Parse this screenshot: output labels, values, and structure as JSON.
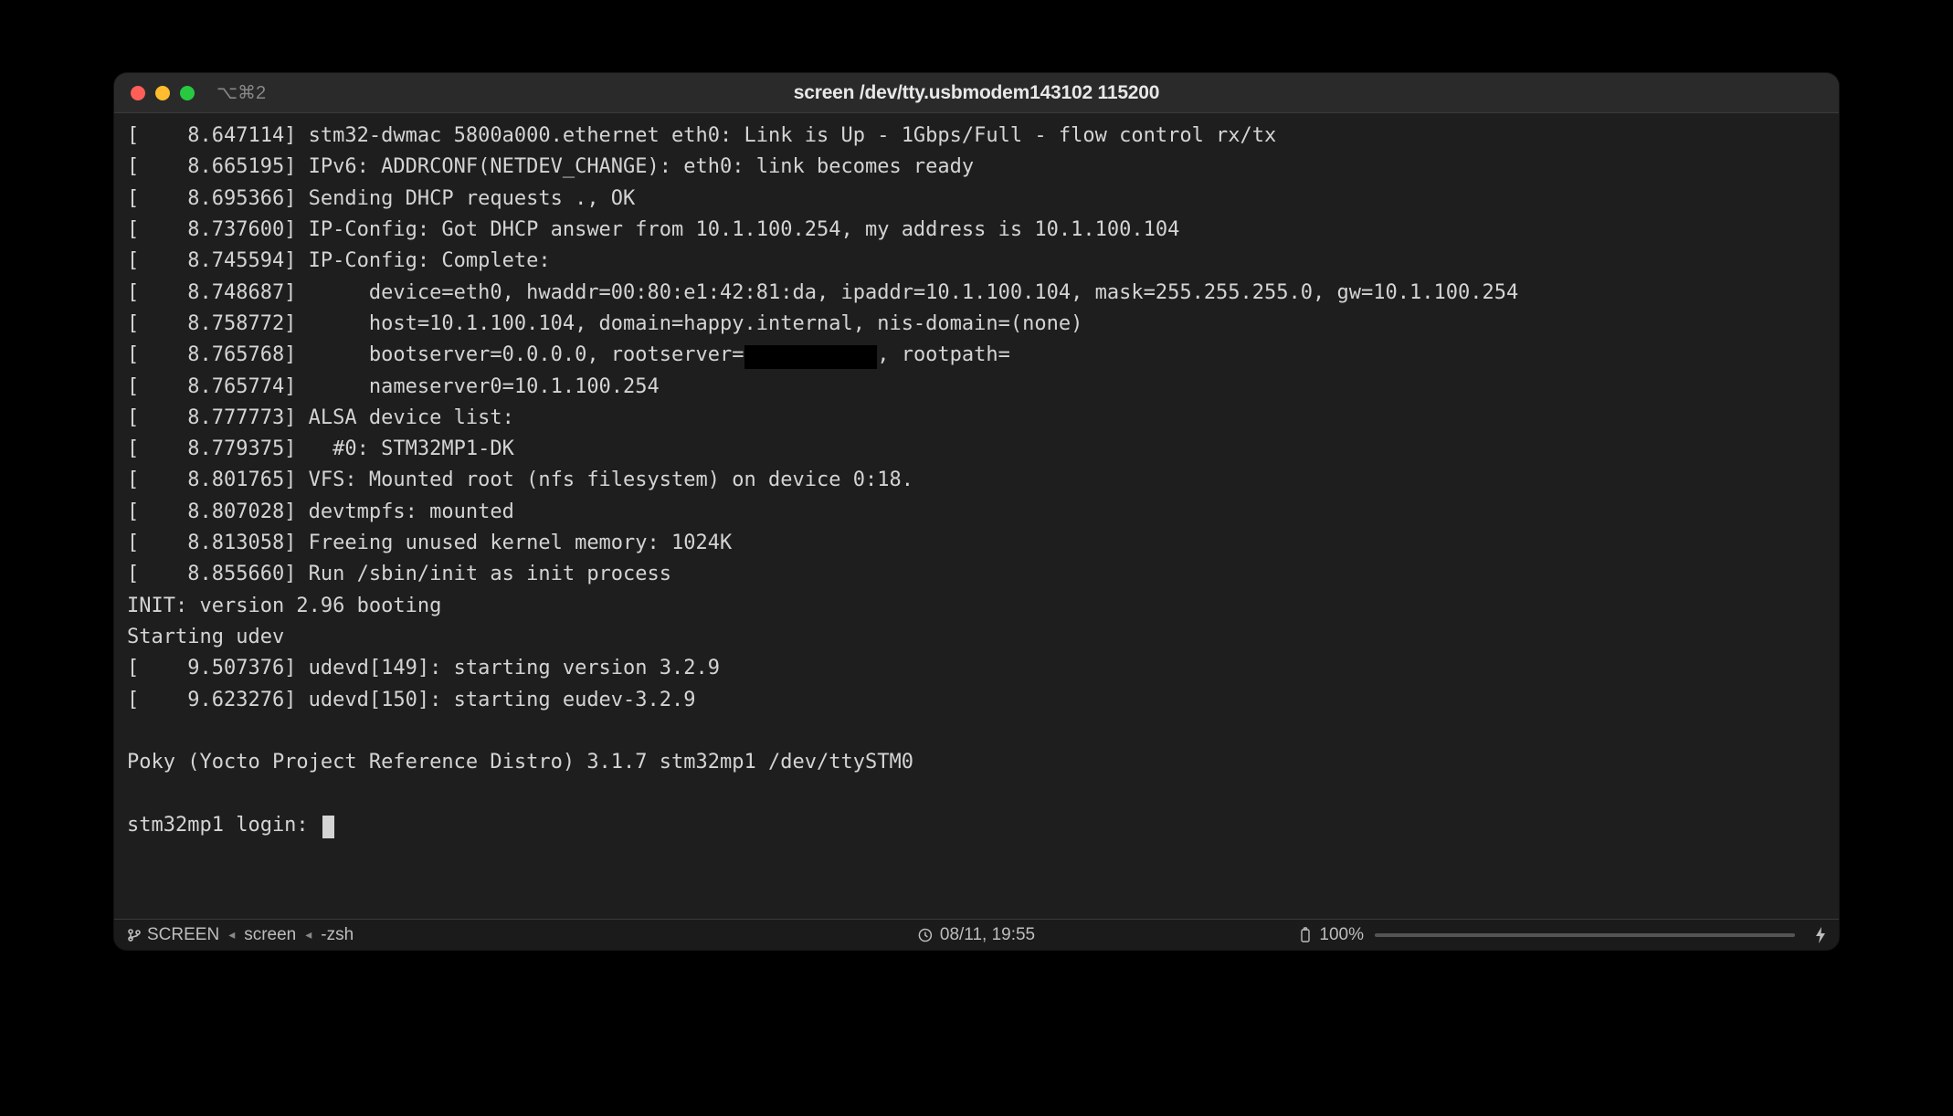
{
  "window": {
    "title": "screen /dev/tty.usbmodem143102 115200",
    "session_hint": "⌥⌘2"
  },
  "terminal": {
    "lines": [
      "[    8.647114] stm32-dwmac 5800a000.ethernet eth0: Link is Up - 1Gbps/Full - flow control rx/tx",
      "[    8.665195] IPv6: ADDRCONF(NETDEV_CHANGE): eth0: link becomes ready",
      "[    8.695366] Sending DHCP requests ., OK",
      "[    8.737600] IP-Config: Got DHCP answer from 10.1.100.254, my address is 10.1.100.104",
      "[    8.745594] IP-Config: Complete:",
      "[    8.748687]      device=eth0, hwaddr=00:80:e1:42:81:da, ipaddr=10.1.100.104, mask=255.255.255.0, gw=10.1.100.254",
      "[    8.758772]      host=10.1.100.104, domain=happy.internal, nis-domain=(none)",
      {
        "pre": "[    8.765768]      bootserver=0.0.0.0, rootserver=",
        "redact": true,
        "post": ", rootpath="
      },
      "[    8.765774]      nameserver0=10.1.100.254",
      "[    8.777773] ALSA device list:",
      "[    8.779375]   #0: STM32MP1-DK",
      "[    8.801765] VFS: Mounted root (nfs filesystem) on device 0:18.",
      "[    8.807028] devtmpfs: mounted",
      "[    8.813058] Freeing unused kernel memory: 1024K",
      "[    8.855660] Run /sbin/init as init process",
      "INIT: version 2.96 booting",
      "Starting udev",
      "[    9.507376] udevd[149]: starting version 3.2.9",
      "[    9.623276] udevd[150]: starting eudev-3.2.9",
      "",
      "Poky (Yocto Project Reference Distro) 3.1.7 stm32mp1 /dev/ttySTM0",
      ""
    ],
    "prompt": "stm32mp1 login: "
  },
  "statusbar": {
    "process": "SCREEN",
    "session": "screen",
    "shell": "-zsh",
    "datetime": "08/11, 19:55",
    "battery": "100%"
  }
}
